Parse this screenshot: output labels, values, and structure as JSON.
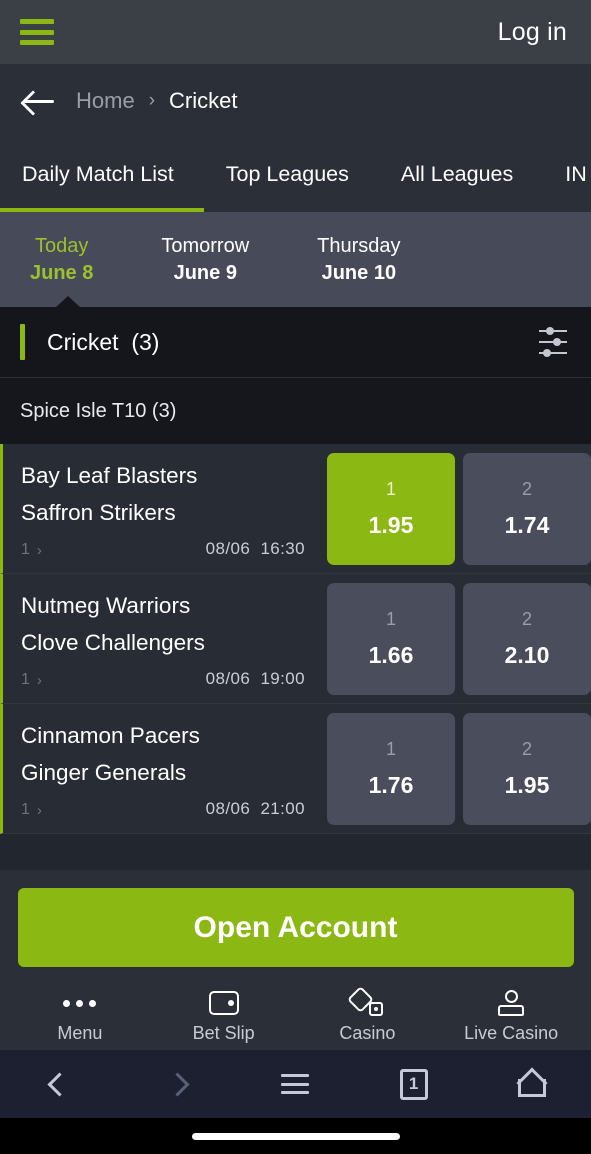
{
  "topbar": {
    "menu_icon": "hamburger-icon",
    "login_label": "Log in"
  },
  "breadcrumb": {
    "back_icon": "arrow-left-icon",
    "home_label": "Home",
    "separator": "›",
    "current_label": "Cricket"
  },
  "tabs": [
    {
      "label": "Daily Match List",
      "active": true
    },
    {
      "label": "Top Leagues",
      "active": false
    },
    {
      "label": "All Leagues",
      "active": false
    },
    {
      "label": "IN P",
      "active": false
    }
  ],
  "dates": [
    {
      "day": "Today",
      "date": "June 8",
      "active": true
    },
    {
      "day": "Tomorrow",
      "date": "June 9",
      "active": false
    },
    {
      "day": "Thursday",
      "date": "June 10",
      "active": false
    }
  ],
  "sport_header": {
    "title": "Cricket",
    "count": "(3)",
    "filter_icon": "filter-sliders-icon"
  },
  "league": {
    "name": "Spice Isle T10 (3)"
  },
  "matches": [
    {
      "team1": "Bay Leaf Blasters",
      "team2": "Saffron Strikers",
      "market_count": "1",
      "chevron": "›",
      "date": "08/06",
      "time": "16:30",
      "odds": [
        {
          "label": "1",
          "value": "1.95",
          "selected": true
        },
        {
          "label": "2",
          "value": "1.74",
          "selected": false
        }
      ]
    },
    {
      "team1": "Nutmeg Warriors",
      "team2": "Clove Challengers",
      "market_count": "1",
      "chevron": "›",
      "date": "08/06",
      "time": "19:00",
      "odds": [
        {
          "label": "1",
          "value": "1.66",
          "selected": false
        },
        {
          "label": "2",
          "value": "2.10",
          "selected": false
        }
      ]
    },
    {
      "team1": "Cinnamon Pacers",
      "team2": "Ginger Generals",
      "market_count": "1",
      "chevron": "›",
      "date": "08/06",
      "time": "21:00",
      "odds": [
        {
          "label": "1",
          "value": "1.76",
          "selected": false
        },
        {
          "label": "2",
          "value": "1.95",
          "selected": false
        }
      ]
    }
  ],
  "cta": {
    "label": "Open Account"
  },
  "bottom_nav": [
    {
      "label": "Menu",
      "icon": "ellipsis-icon"
    },
    {
      "label": "Bet Slip",
      "icon": "wallet-icon"
    },
    {
      "label": "Casino",
      "icon": "dice-icon"
    },
    {
      "label": "Live Casino",
      "icon": "dealer-icon"
    }
  ],
  "system_bar": {
    "back_icon": "chevron-left-icon",
    "forward_icon": "chevron-right-icon",
    "menu_icon": "hamburger-icon",
    "tab_count": "1",
    "home_icon": "home-icon"
  },
  "colors": {
    "accent_green": "#8cb813",
    "accent_green_text": "#9ec02c",
    "topbar_bg": "#3b3f46",
    "panel_bg": "#2b2f38",
    "dates_bg": "#474b59",
    "sport_hdr_bg": "#14161c",
    "match_bg": "#282c34",
    "odd_bg": "#4a4e5c",
    "sysbar_bg": "#1c2030"
  }
}
